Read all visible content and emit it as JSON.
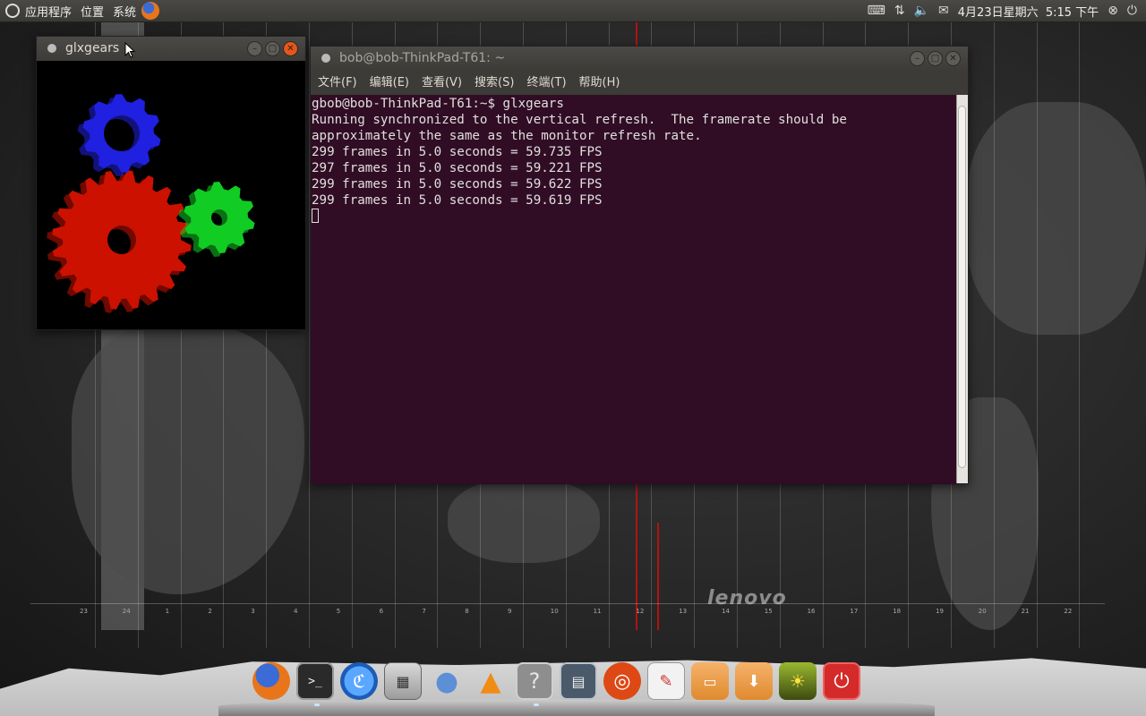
{
  "top_panel": {
    "menus": [
      "应用程序",
      "位置",
      "系统"
    ],
    "clock": "4月23日星期六  5:15 下午",
    "tray_icons": [
      "keyboard-icon",
      "network-icon",
      "volume-icon",
      "mail-icon",
      "user-icon",
      "power-icon"
    ]
  },
  "glxgears_window": {
    "title": "glxgears",
    "gear_colors": {
      "big": "#cc1100",
      "blue": "#2020e0",
      "green": "#11cc22"
    }
  },
  "terminal_window": {
    "title": "bob@bob-ThinkPad-T61: ~",
    "menus": [
      "文件(F)",
      "编辑(E)",
      "查看(V)",
      "搜索(S)",
      "终端(T)",
      "帮助(H)"
    ],
    "lines": [
      "gbob@bob-ThinkPad-T61:~$ glxgears",
      "Running synchronized to the vertical refresh.  The framerate should be",
      "approximately the same as the monitor refresh rate.",
      "299 frames in 5.0 seconds = 59.735 FPS",
      "297 frames in 5.0 seconds = 59.221 FPS",
      "299 frames in 5.0 seconds = 59.622 FPS",
      "299 frames in 5.0 seconds = 59.619 FPS"
    ],
    "background": "#300a24"
  },
  "wallpaper": {
    "brand": "lenovo",
    "timezone_ticks": [
      "23",
      "24",
      "1",
      "2",
      "3",
      "4",
      "5",
      "6",
      "7",
      "8",
      "9",
      "10",
      "11",
      "12",
      "13",
      "14",
      "15",
      "16",
      "17",
      "18",
      "19",
      "20",
      "21",
      "22"
    ]
  },
  "dock": {
    "items": [
      {
        "name": "firefox",
        "icon": "firefox-icon"
      },
      {
        "name": "terminal",
        "icon": "terminal-icon"
      },
      {
        "name": "thunderbird",
        "icon": "thunderbird-icon"
      },
      {
        "name": "calculator",
        "icon": "calculator-icon"
      },
      {
        "name": "pidgin",
        "icon": "pidgin-icon"
      },
      {
        "name": "vlc",
        "icon": "vlc-icon"
      },
      {
        "name": "help",
        "icon": "help-icon"
      },
      {
        "name": "file-viewer",
        "icon": "document-viewer-icon"
      },
      {
        "name": "ubuntu-software",
        "icon": "ubuntu-icon"
      },
      {
        "name": "text-editor",
        "icon": "text-editor-icon"
      },
      {
        "name": "home-folder",
        "icon": "folder-icon"
      },
      {
        "name": "downloads-folder",
        "icon": "downloads-folder-icon"
      },
      {
        "name": "photos",
        "icon": "photos-icon"
      },
      {
        "name": "shutdown",
        "icon": "shutdown-icon"
      }
    ]
  }
}
